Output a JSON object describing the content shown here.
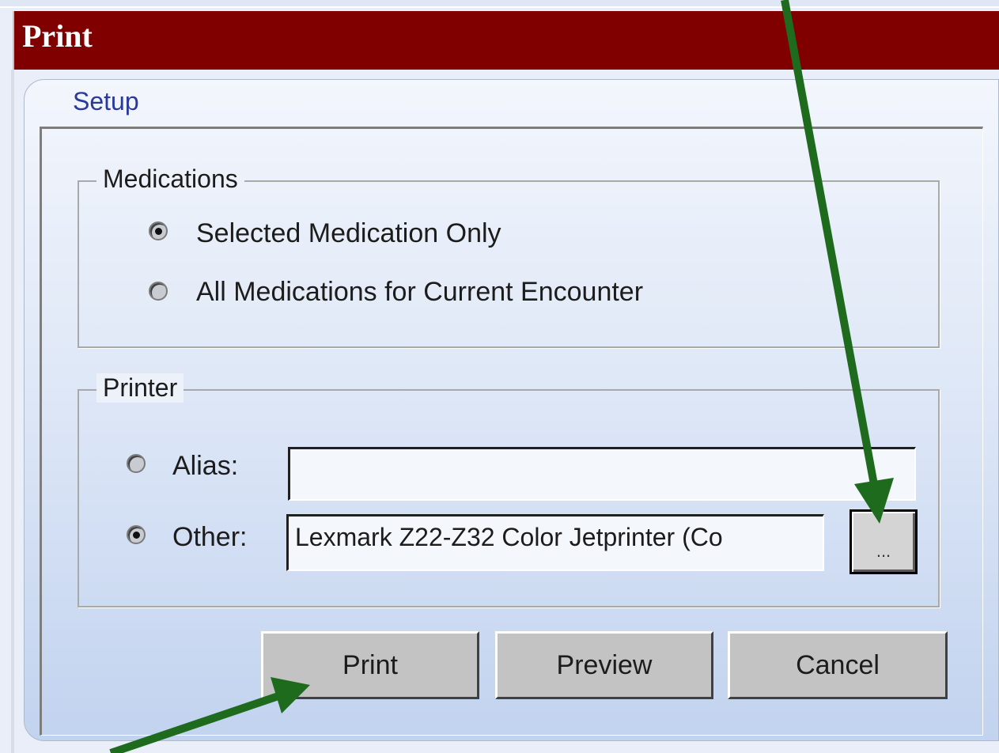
{
  "window": {
    "title": "Print"
  },
  "tab": {
    "label": "Setup"
  },
  "medications": {
    "legend": "Medications",
    "options": [
      {
        "label": "Selected Medication Only",
        "checked": true
      },
      {
        "label": "All Medications for Current Encounter",
        "checked": false
      }
    ]
  },
  "printer": {
    "legend": "Printer",
    "alias": {
      "label": "Alias:",
      "value": "",
      "checked": false
    },
    "other": {
      "label": "Other:",
      "value": "Lexmark Z22-Z32 Color Jetprinter (Co",
      "checked": true
    },
    "browse_label": "..."
  },
  "buttons": {
    "print": "Print",
    "preview": "Preview",
    "cancel": "Cancel"
  },
  "colors": {
    "titlebar": "#800000",
    "annotation_arrow": "#1e6b1e"
  }
}
